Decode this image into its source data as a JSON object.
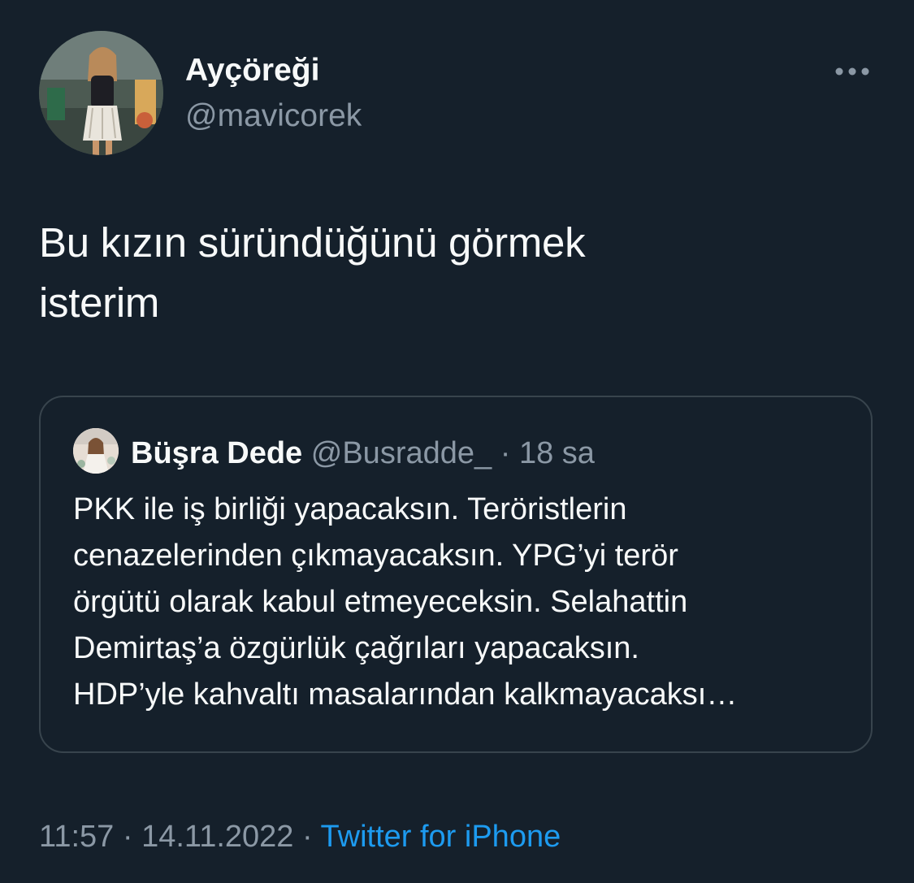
{
  "author": {
    "name": "Ayçöreği",
    "handle": "@mavicorek"
  },
  "more_icon": "more-horizontal-icon",
  "tweet": {
    "text": "Bu kızın süründüğünü görmek\nisterim"
  },
  "quote": {
    "name": "Büşra Dede",
    "handle": "@Busradde_",
    "separator": " · ",
    "time": "18 sa",
    "text": "PKK ile iş birliği yapacaksın. Teröristlerin\ncenazelerinden çıkmayacaksın. YPG’yi terör\nörgütü olarak kabul etmeyeceksin. Selahattin\nDemirtaş’a özgürlük çağrıları yapacaksın.\nHDP’yle kahvaltı masalarından kalkmayacaksı…"
  },
  "footer": {
    "time": "11:57",
    "sep1": " · ",
    "date": "14.11.2022",
    "sep2": " · ",
    "source": "Twitter for iPhone"
  },
  "colors": {
    "background": "#15202b",
    "text": "#f7f9f9",
    "secondary": "#8b98a5",
    "link": "#1d9bf0",
    "border": "#38444d"
  }
}
